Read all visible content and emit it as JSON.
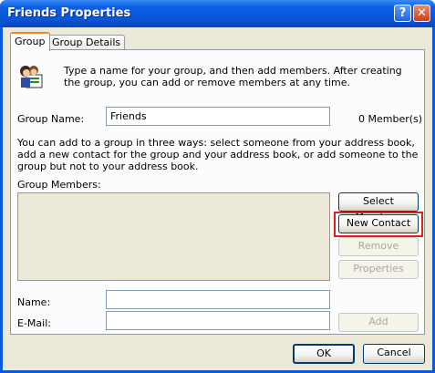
{
  "window": {
    "title": "Friends Properties",
    "help_glyph": "?",
    "close_glyph": "✕"
  },
  "tabs": [
    {
      "label": "Group"
    },
    {
      "label": "Group Details"
    }
  ],
  "intro": "Type a name for your group, and then add members. After creating the group, you can add or remove members at any time.",
  "group_name": {
    "label": "Group Name:",
    "value": "Friends",
    "member_count": "0 Member(s)"
  },
  "ways_text": "You can add to a group in three ways: select someone from your address book, add a new contact for the group and your address book, or add someone to the group but not to your address book.",
  "members": {
    "label": "Group Members:"
  },
  "buttons": {
    "select_members": "Select Members",
    "new_contact": "New Contact",
    "remove": "Remove",
    "properties": "Properties",
    "add": "Add",
    "ok": "OK",
    "cancel": "Cancel"
  },
  "name_field": {
    "label": "Name:",
    "value": ""
  },
  "email_field": {
    "label": "E-Mail:",
    "value": ""
  },
  "colors": {
    "highlight": "#e02020",
    "title_bar": "#0a55d8",
    "active_tab_accent": "#e68b2c"
  }
}
